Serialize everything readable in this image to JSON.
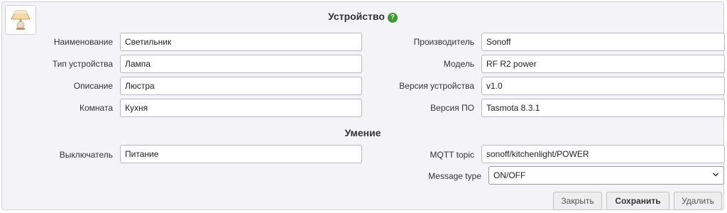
{
  "device_section": {
    "title": "Устройство",
    "help_icon": "question-icon",
    "left_fields": [
      {
        "label": "Наименование",
        "value": "Светильник"
      },
      {
        "label": "Тип устройства",
        "value": "Лампа"
      },
      {
        "label": "Описание",
        "value": "Люстра"
      },
      {
        "label": "Комната",
        "value": "Кухня"
      }
    ],
    "right_fields": [
      {
        "label": "Производитель",
        "value": "Sonoff"
      },
      {
        "label": "Модель",
        "value": "RF R2 power"
      },
      {
        "label": "Версия устройства",
        "value": "v1.0"
      },
      {
        "label": "Версия ПО",
        "value": "Tasmota 8.3.1"
      }
    ]
  },
  "skill_section": {
    "title": "Умение",
    "switch_label": "Выключатель",
    "switch_value": "Питание",
    "mqtt_label": "MQTT topic",
    "mqtt_value": "sonoff/kitchenlight/POWER",
    "message_type_label": "Message type",
    "message_type_value": "ON/OFF"
  },
  "buttons": {
    "close": "Закрыть",
    "save": "Сохранить",
    "delete": "Удалить"
  },
  "colors": {
    "panel_bg": "#f3f3f8",
    "help_green": "#3a9a2e"
  }
}
